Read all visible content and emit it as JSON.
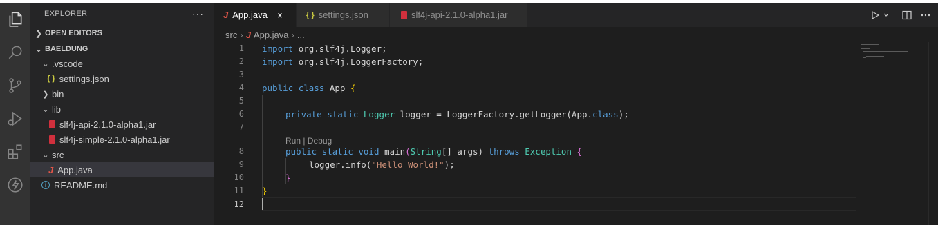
{
  "sidebar": {
    "title": "EXPLORER",
    "more": "···",
    "open_editors": "OPEN EDITORS",
    "folder": "BAELDUNG",
    "tree": [
      {
        "label": ".vscode"
      },
      {
        "label": "settings.json"
      },
      {
        "label": "bin"
      },
      {
        "label": "lib"
      },
      {
        "label": "slf4j-api-2.1.0-alpha1.jar"
      },
      {
        "label": "slf4j-simple-2.1.0-alpha1.jar"
      },
      {
        "label": "src"
      },
      {
        "label": "App.java"
      },
      {
        "label": "README.md"
      }
    ],
    "icons": {
      "json": "{ }",
      "java": "J",
      "info": "i"
    }
  },
  "tabs": [
    {
      "label": "App.java",
      "icon": "J",
      "close": "×"
    },
    {
      "label": "settings.json",
      "icon": "{ }"
    },
    {
      "label": "slf4j-api-2.1.0-alpha1.jar"
    }
  ],
  "breadcrumb": {
    "folder": "src",
    "file": "App.java",
    "more": "..."
  },
  "codelens": "Run | Debug",
  "lines": [
    {
      "n": "1",
      "t": "org.slf4j.Logger;"
    },
    {
      "n": "2",
      "t": "org.slf4j.LoggerFactory;"
    },
    {
      "n": "3"
    },
    {
      "n": "4"
    },
    {
      "n": "5"
    },
    {
      "n": "6"
    },
    {
      "n": "7"
    },
    {
      "n": "8"
    },
    {
      "n": "9"
    },
    {
      "n": "10"
    },
    {
      "n": "11"
    },
    {
      "n": "12"
    }
  ],
  "tokens": {
    "import": "import",
    "public": "public",
    "class": "class",
    "app": "App",
    "lbrace": "{",
    "rbrace": "}",
    "private": "private",
    "static": "static",
    "logger_type": "Logger",
    "decl": " logger = LoggerFactory.getLogger(App.",
    "class_kw": "class",
    "decl_end": ");",
    "void": "void",
    "main": "main",
    "string_type": "String",
    "args": "[] args)",
    "throws": "throws",
    "exception": "Exception",
    "logger_call": "logger.info(",
    "hello": "\"Hello World!\"",
    "call_end": ");",
    "lparen": "("
  },
  "colors": {
    "keyword": "#569cd6",
    "type": "#4ec9b0",
    "string": "#ce9178",
    "bracket": "#ffd700",
    "bracket2": "#da70d6"
  }
}
